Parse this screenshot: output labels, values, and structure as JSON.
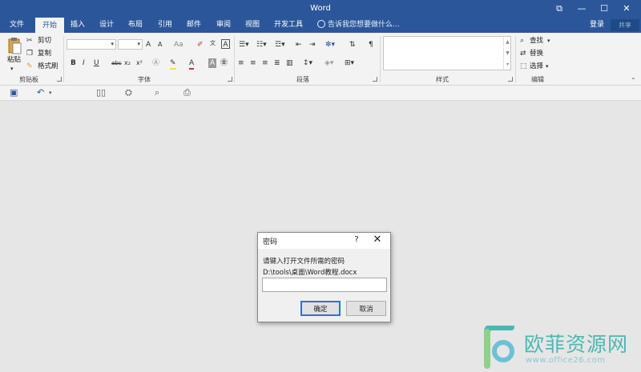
{
  "window": {
    "title": "Word",
    "controls": {
      "restore": "⧉",
      "minimize": "—",
      "maximize": "☐",
      "close": "✕"
    }
  },
  "tabs": [
    "文件",
    "开始",
    "插入",
    "设计",
    "布局",
    "引用",
    "邮件",
    "审阅",
    "视图",
    "开发工具"
  ],
  "active_tab": "开始",
  "tell_me": "告诉我您想要做什么...",
  "account": {
    "login": "登录",
    "share": "共享"
  },
  "ribbon": {
    "clipboard": {
      "label": "剪贴板",
      "paste": "粘贴",
      "cut": "剪切",
      "copy": "复制",
      "format_painter": "格式刷"
    },
    "font": {
      "label": "字体",
      "bold": "B",
      "italic": "I",
      "underline": "U",
      "strike": "abc",
      "subscript": "x₂",
      "superscript": "x²",
      "grow": "A",
      "shrink": "A",
      "case": "Aa",
      "color_a": "A",
      "char_shading": "A",
      "char_border": "A",
      "phonetic": "文"
    },
    "paragraph": {
      "label": "段落"
    },
    "styles": {
      "label": "样式"
    },
    "editing": {
      "label": "编辑",
      "find": "查找",
      "replace": "替换",
      "select": "选择"
    }
  },
  "colors": {
    "accent": "#2b579a",
    "ribbon_bg": "#f3f3f3",
    "canvas_bg": "#e6e6e6"
  },
  "dialog": {
    "title": "密码",
    "help": "?",
    "close": "✕",
    "prompt": "请键入打开文件所需的密码",
    "file_path": "D:\\tools\\桌面\\Word教程.docx",
    "password_value": "",
    "ok": "确定",
    "cancel": "取消"
  },
  "watermark": {
    "brand": "欧菲资源网",
    "url": "www.office26.com"
  }
}
